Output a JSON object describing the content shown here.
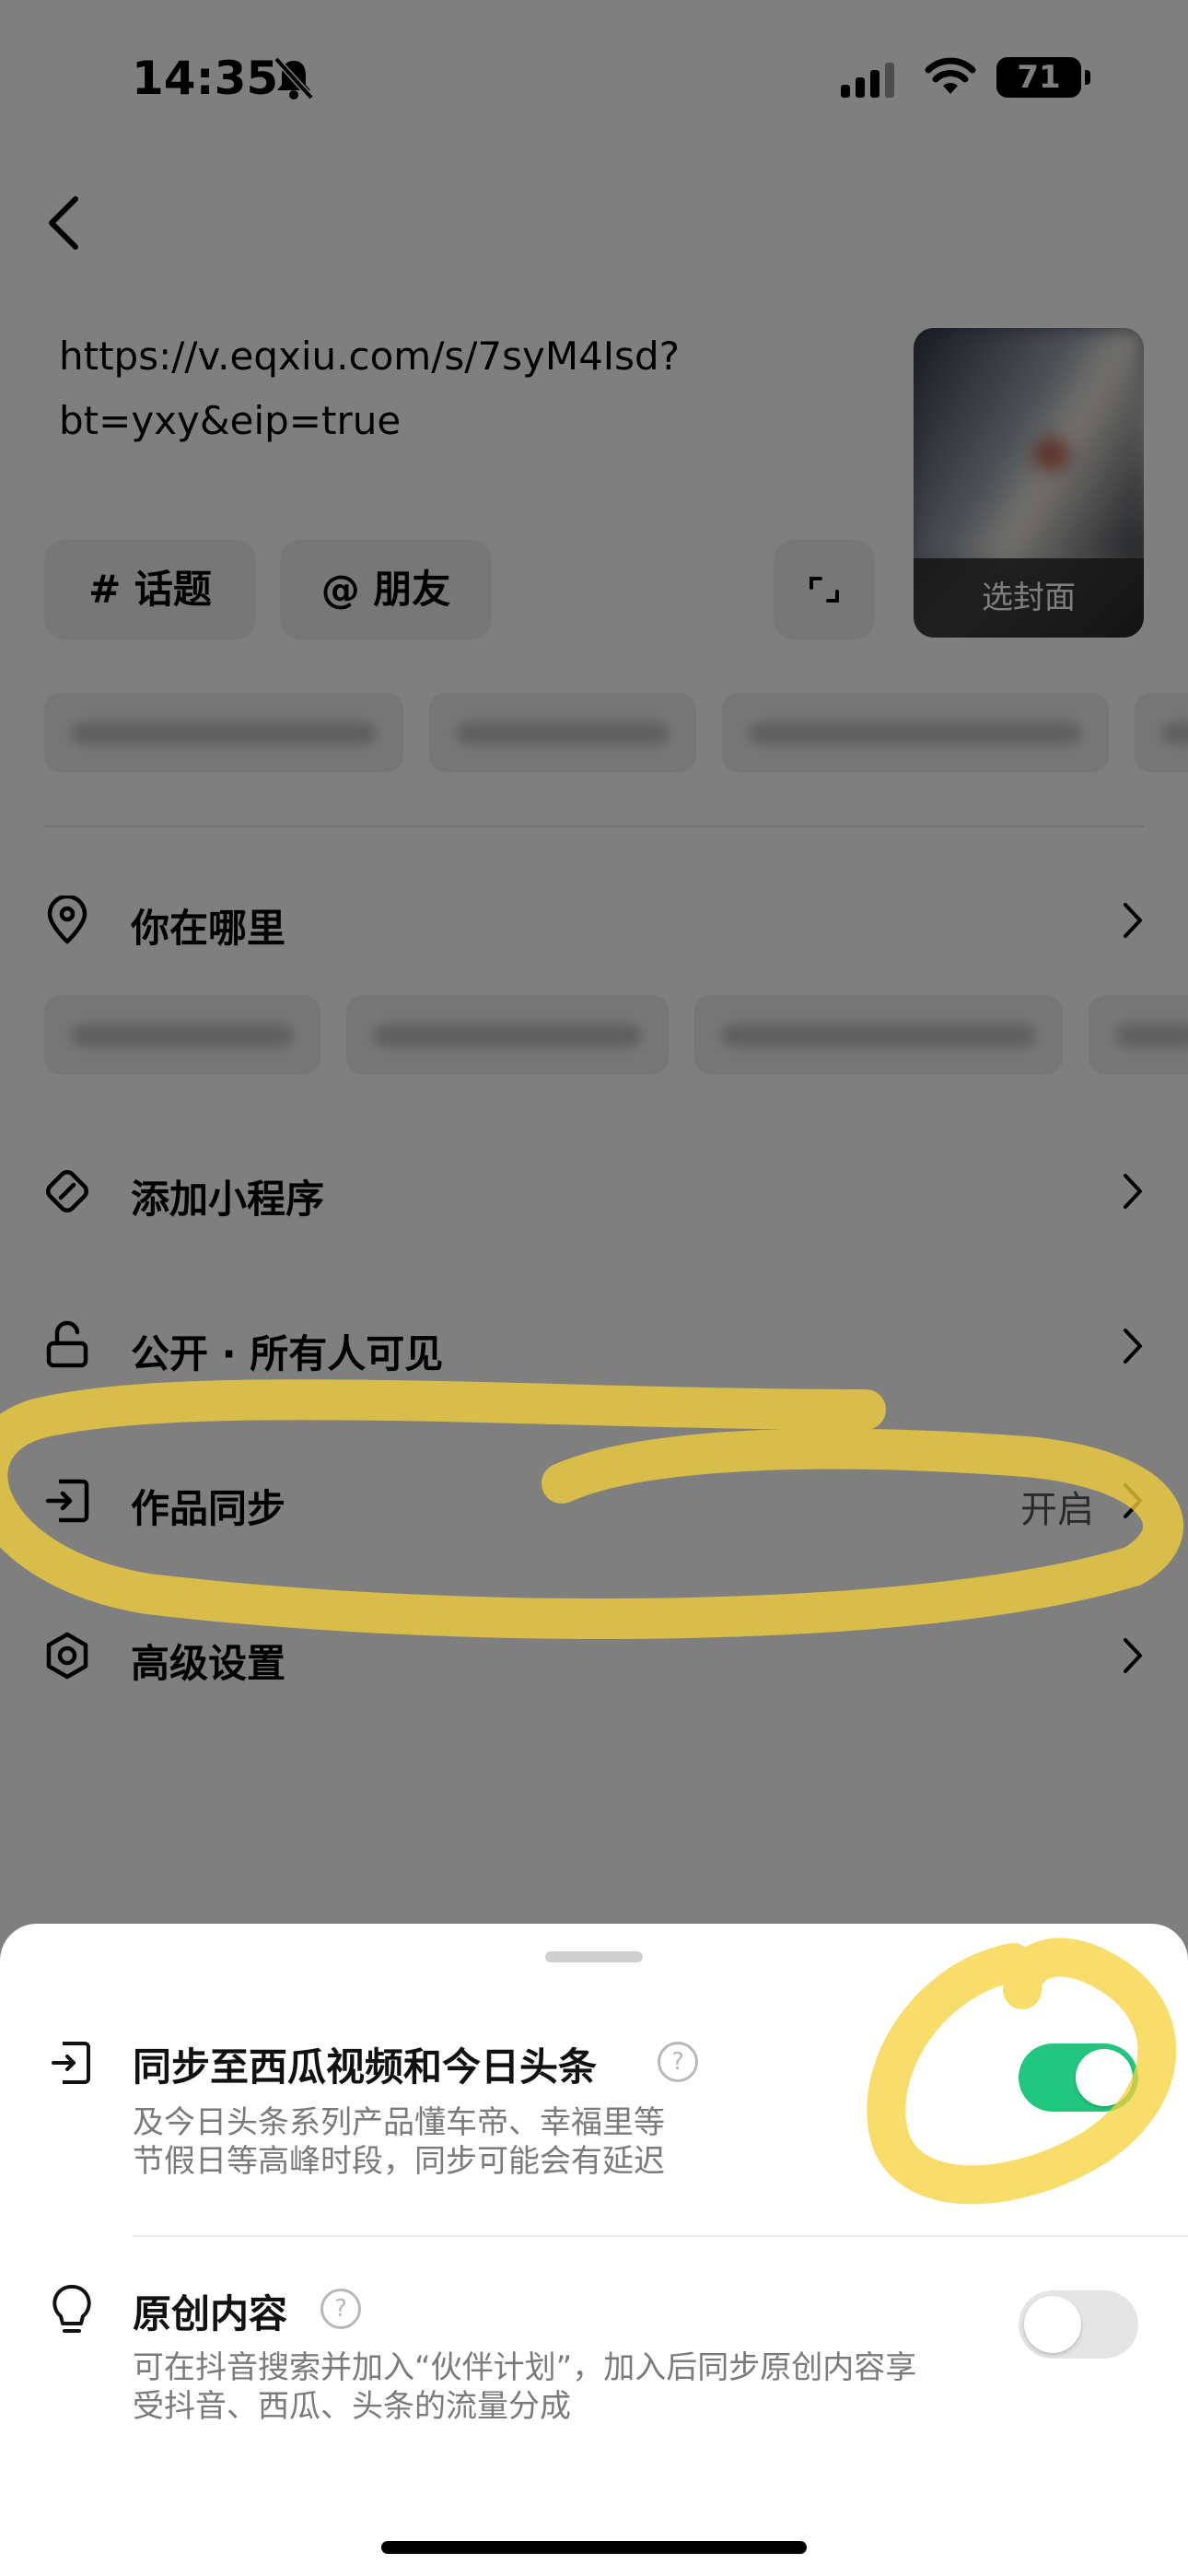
{
  "status_bar": {
    "time": "14:35",
    "battery": "71"
  },
  "post": {
    "url_text": "https://v.eqxiu.com/s/7syM4Isd?bt=yxy&eip=true",
    "cover_label": "选封面"
  },
  "chips": {
    "topic": "# 话题",
    "friend": "@ 朋友"
  },
  "rows": {
    "location": "你在哪里",
    "mini_program": "添加小程序",
    "visibility": "公开 · 所有人可见",
    "sync": "作品同步",
    "sync_value": "开启",
    "advanced": "高级设置"
  },
  "sheet": {
    "sync_title": "同步至西瓜视频和今日头条",
    "sync_desc_line1": "及今日头条系列产品懂车帝、幸福里等",
    "sync_desc_line2": "节假日等高峰时段，同步可能会有延迟",
    "sync_enabled": true,
    "original_title": "原创内容",
    "original_desc_line1": "可在抖音搜索并加入“伙伴计划”，加入后同步原创内容享",
    "original_desc_line2": "受抖音、西瓜、头条的流量分成",
    "original_enabled": false,
    "help_glyph": "?"
  },
  "colors": {
    "toggle_on": "#21c77e",
    "toggle_off": "#e5e5e5",
    "highlight": "#f5d23a"
  },
  "icons": [
    "bell-slash-icon",
    "signal-icon",
    "wifi-icon",
    "back-icon",
    "expand-icon",
    "location-pin-icon",
    "mini-program-icon",
    "unlock-icon",
    "sync-icon",
    "settings-hex-icon",
    "lightbulb-icon",
    "help-icon",
    "chevron-right-icon"
  ]
}
